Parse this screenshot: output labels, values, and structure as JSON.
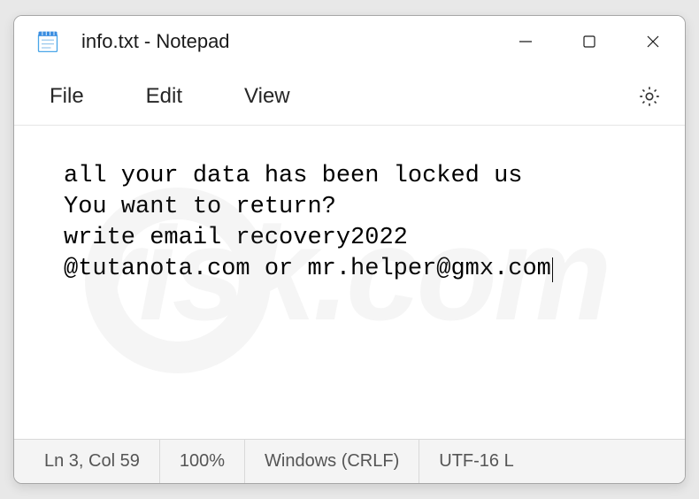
{
  "titlebar": {
    "title": "info.txt - Notepad"
  },
  "menubar": {
    "file": "File",
    "edit": "Edit",
    "view": "View"
  },
  "content": {
    "text": "all your data has been locked us\nYou want to return?\nwrite email recovery2022\n@tutanota.com or mr.helper@gmx.com"
  },
  "statusbar": {
    "position": "Ln 3, Col 59",
    "zoom": "100%",
    "line_ending": "Windows (CRLF)",
    "encoding": "UTF-16 L"
  },
  "watermark": {
    "text": "risk.com"
  }
}
